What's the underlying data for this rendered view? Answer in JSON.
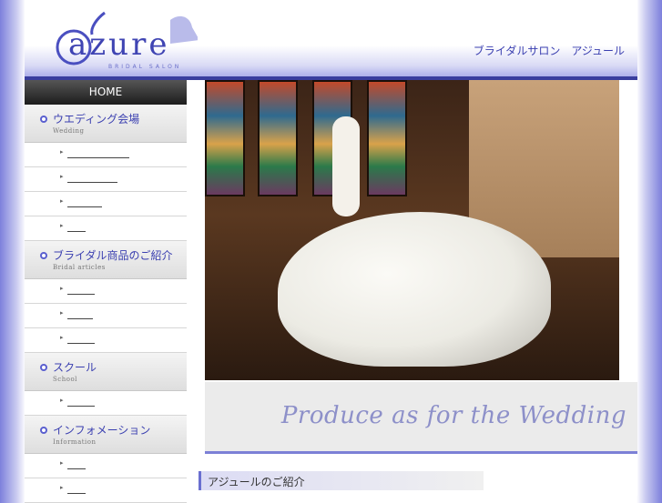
{
  "header": {
    "logo_text": "azure",
    "logo_sub": "BRIDAL SALON",
    "tagline": "ブライダルサロン　アジュール"
  },
  "sidebar": {
    "home": "HOME",
    "categories": [
      {
        "jp": "ウエディング会場",
        "en": "Wedding",
        "sub_count": 4
      },
      {
        "jp": "ブライダル商品のご紹介",
        "en": "Bridal articles",
        "sub_count": 3
      },
      {
        "jp": "スクール",
        "en": "School",
        "sub_count": 1
      },
      {
        "jp": "インフォメーション",
        "en": "Information",
        "sub_count": 2
      }
    ]
  },
  "main": {
    "banner_text": "Produce as for the Wedding",
    "intro_heading": "アジュールのご紹介"
  },
  "colors": {
    "accent": "#3f44b3",
    "header_bar": "#3a3e9e",
    "banner_line": "#7c80d6"
  }
}
